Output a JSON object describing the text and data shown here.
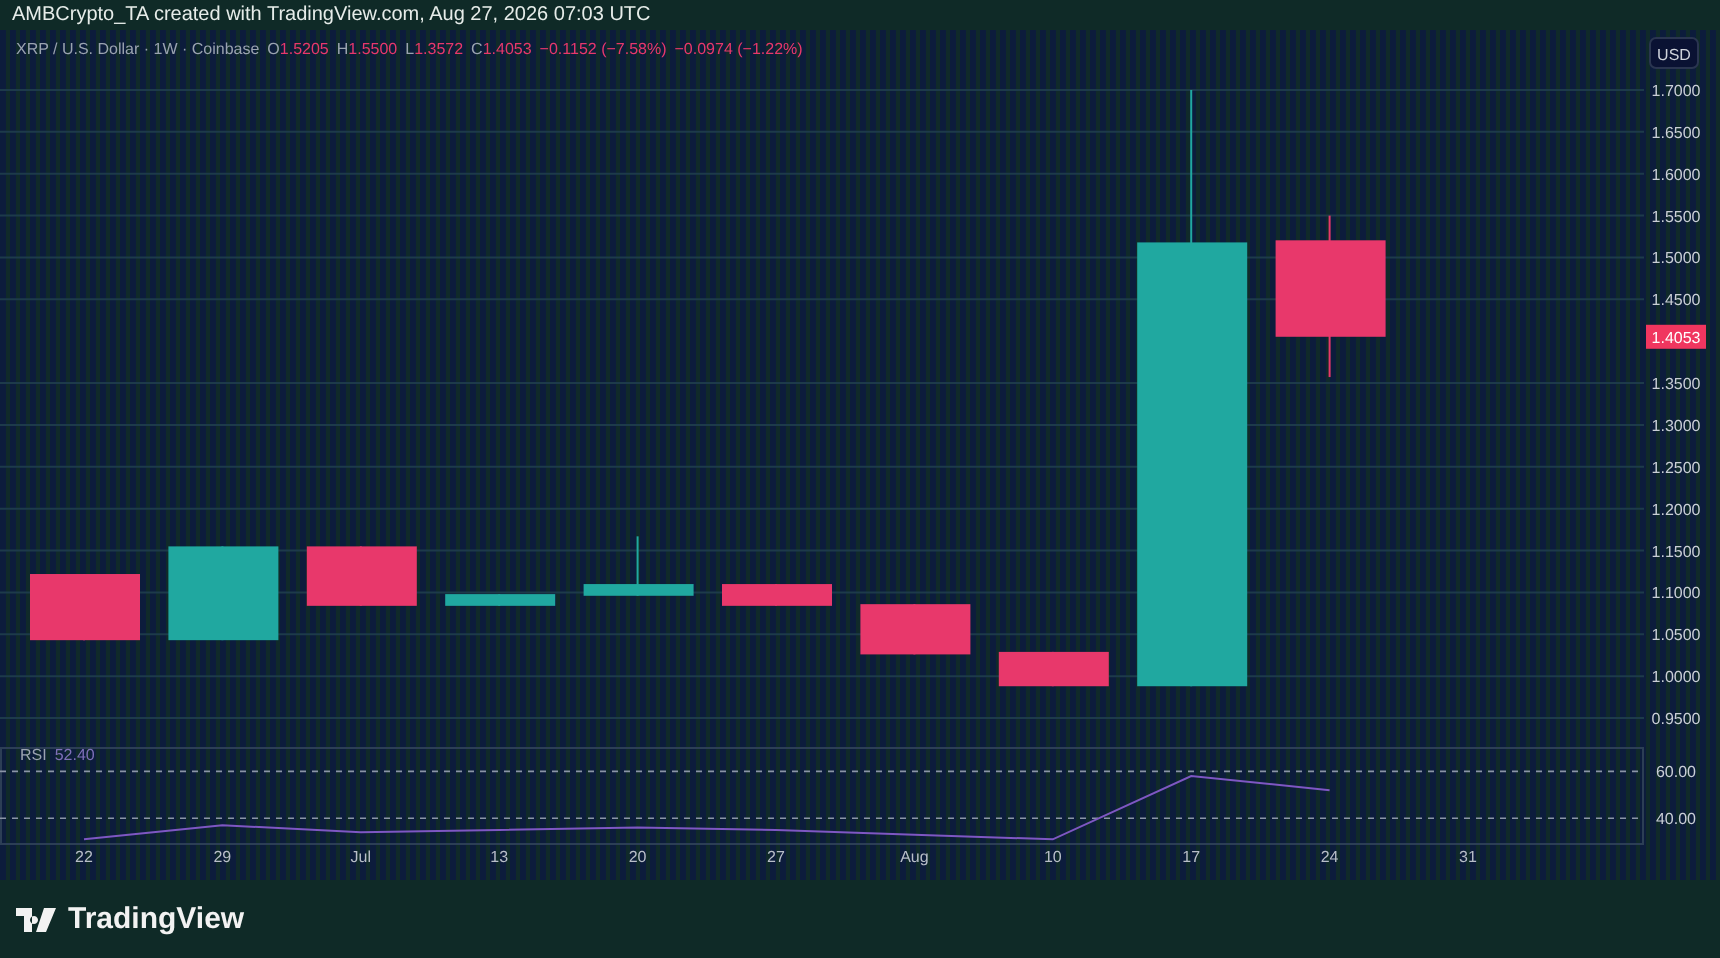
{
  "header": {
    "caption": "AMBCrypto_TA created with TradingView.com, Aug 27, 2026 07:03 UTC"
  },
  "price_chart": {
    "legend": {
      "symbol": "XRP / U.S. Dollar · 1W · Coinbase",
      "open": "O1.5205",
      "high": "H1.5500",
      "low": "L1.3572",
      "close": "C1.4053",
      "change": "−0.1152 (−7.58%)",
      "change_2": "−0.0974 (−1.22%)"
    },
    "currency": "USD",
    "last_price": "1.4053",
    "price_axis": [
      "1.7000",
      "1.6500",
      "1.6000",
      "1.5500",
      "1.5000",
      "1.4500",
      "1.3500",
      "1.3000",
      "1.2500",
      "1.2000",
      "1.1500",
      "1.1000",
      "1.0500",
      "1.0000",
      "0.9500"
    ]
  },
  "rsi": {
    "value": "52.40",
    "chart_data": {
      "type": "line",
      "x": [
        "22",
        "29",
        "Jul",
        "13",
        "20",
        "27",
        "Aug",
        "10",
        "17",
        "24",
        "31"
      ],
      "series": [
        {
          "name": "RSI",
          "color": "#7e57c2",
          "values": [
            31,
            37,
            34,
            35,
            36,
            35,
            33,
            31,
            58,
            52,
            null
          ]
        }
      ],
      "ylim": [
        29,
        70
      ],
      "yticks": [
        {
          "value": 60,
          "label": "60.00"
        },
        {
          "value": 40,
          "label": "40.00"
        }
      ],
      "grid": true
    }
  },
  "footer": {
    "brand": "TradingView"
  }
}
